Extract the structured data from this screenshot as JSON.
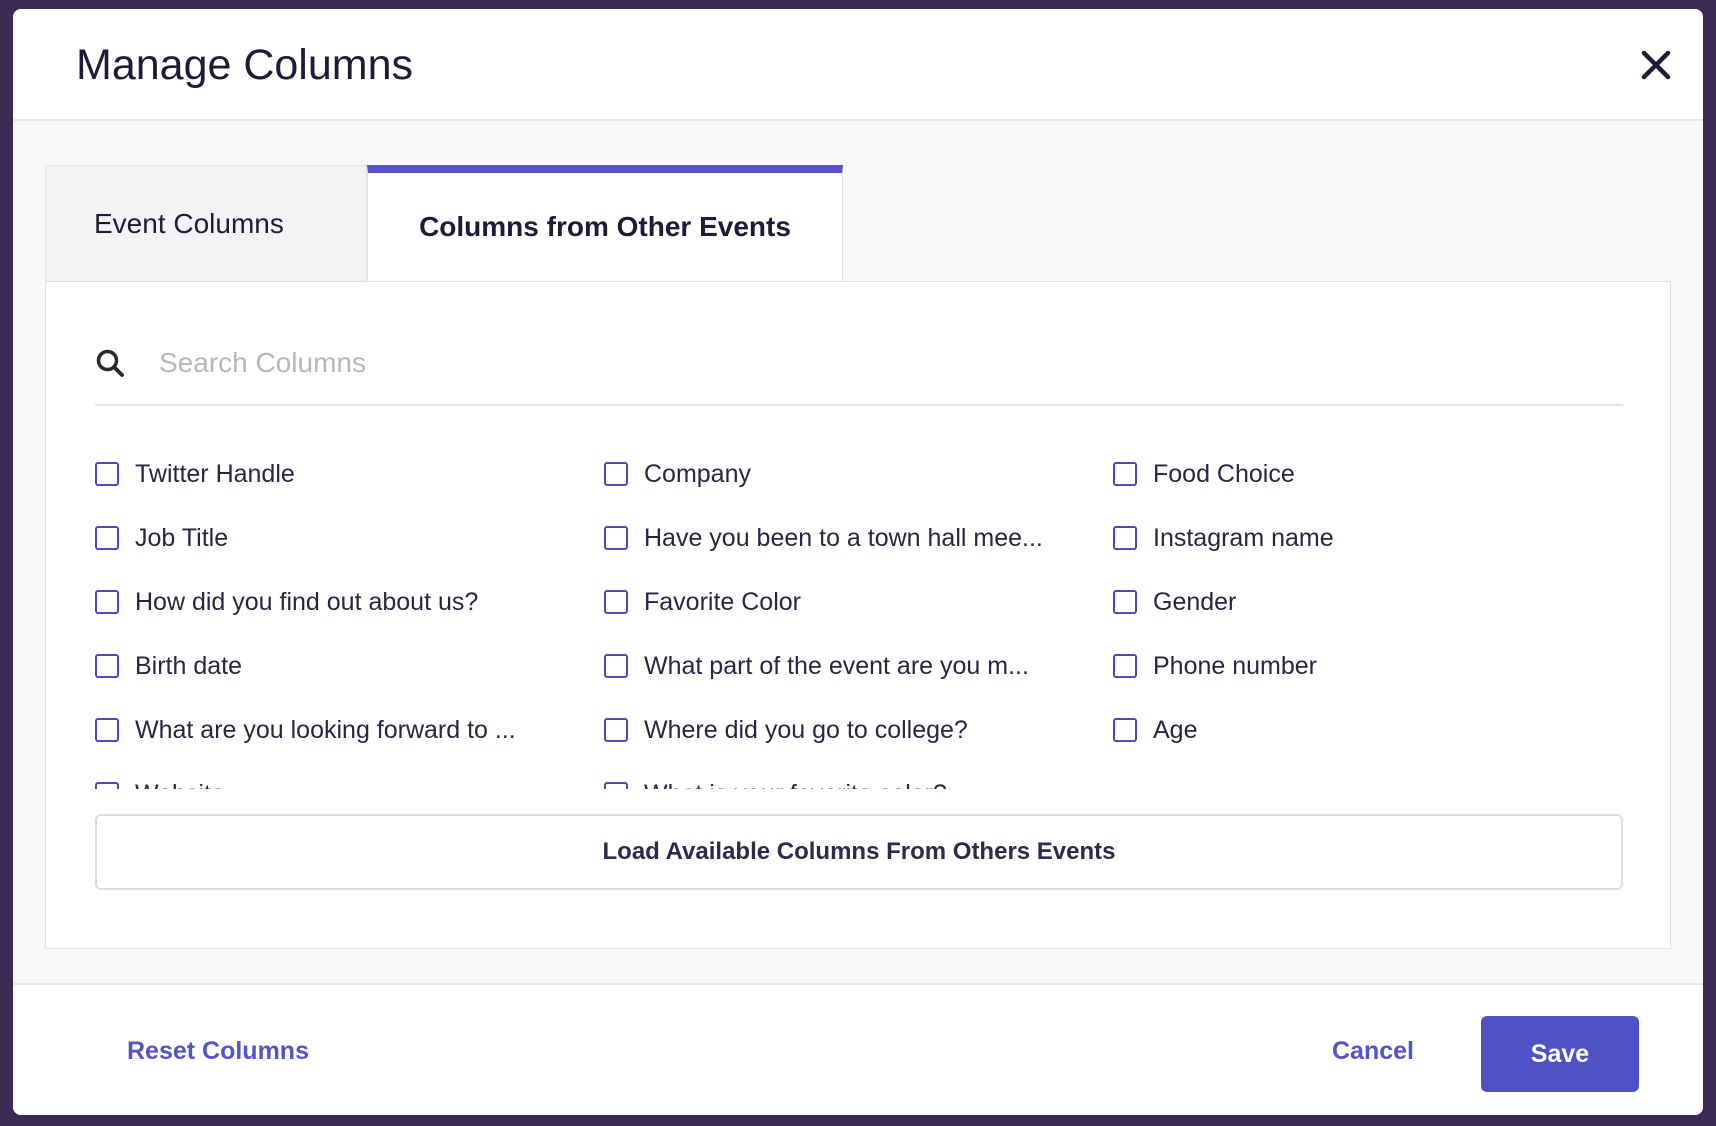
{
  "modal": {
    "title": "Manage Columns"
  },
  "tabs": [
    {
      "label": "Event Columns",
      "active": false
    },
    {
      "label": "Columns from Other Events",
      "active": true
    }
  ],
  "search": {
    "placeholder": "Search Columns",
    "value": ""
  },
  "columns": {
    "col1": [
      {
        "label": "Twitter Handle",
        "checked": false
      },
      {
        "label": "Job Title",
        "checked": false
      },
      {
        "label": "How did you find out about us?",
        "checked": false
      },
      {
        "label": "Birth date",
        "checked": false
      },
      {
        "label": "What are you looking forward to ...",
        "checked": false
      },
      {
        "label": "Website",
        "checked": false
      }
    ],
    "col2": [
      {
        "label": "Company",
        "checked": false
      },
      {
        "label": "Have you been to a town hall mee...",
        "checked": false
      },
      {
        "label": "Favorite Color",
        "checked": false
      },
      {
        "label": "What part of the event are you m...",
        "checked": false
      },
      {
        "label": "Where did you go to college?",
        "checked": false
      },
      {
        "label": "What is your favorite color?",
        "checked": false
      }
    ],
    "col3": [
      {
        "label": "Food Choice",
        "checked": false
      },
      {
        "label": "Instagram name",
        "checked": false
      },
      {
        "label": "Gender",
        "checked": false
      },
      {
        "label": "Phone number",
        "checked": false
      },
      {
        "label": "Age",
        "checked": false
      }
    ]
  },
  "load_button": {
    "label": "Load Available Columns From Others Events"
  },
  "footer": {
    "reset_label": "Reset Columns",
    "cancel_label": "Cancel",
    "save_label": "Save"
  },
  "colors": {
    "accent": "#5151c6",
    "title_text": "#1f1a3a",
    "backdrop": "#3a2a55"
  }
}
